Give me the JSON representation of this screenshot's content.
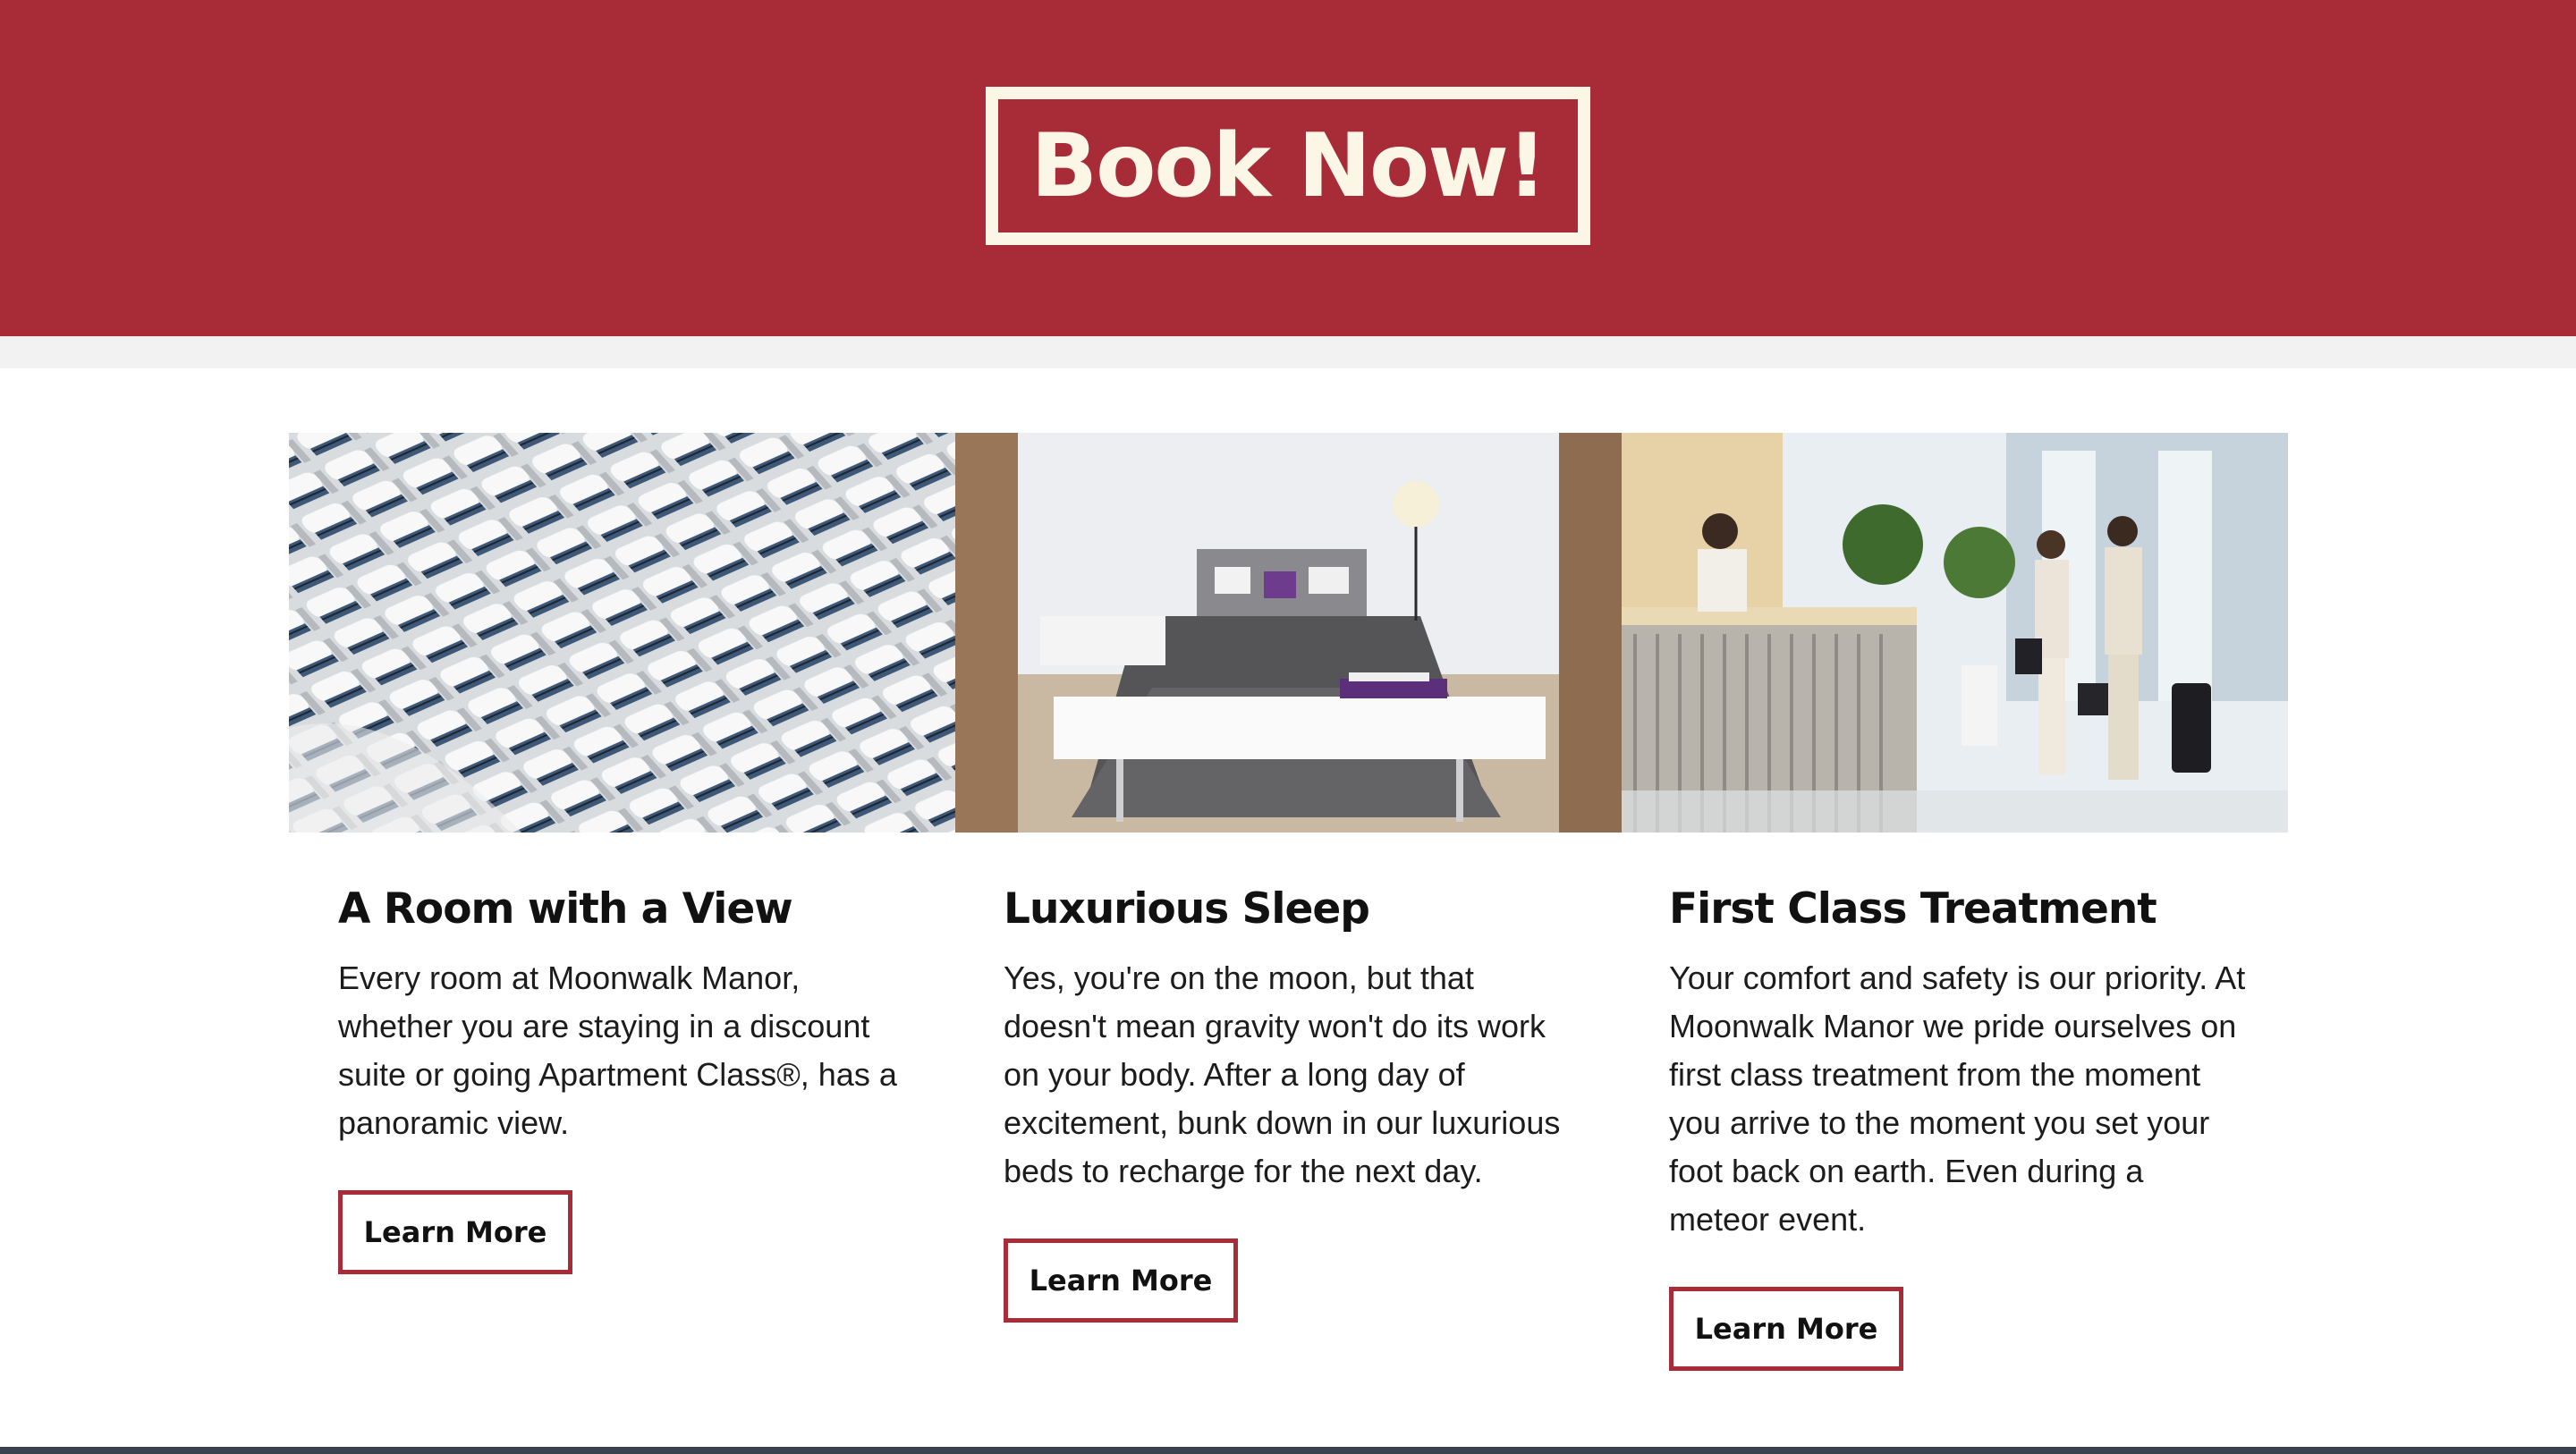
{
  "banner": {
    "book_label": "Book Now!"
  },
  "colors": {
    "accent": "#a72c38",
    "cream": "#fbf6e6",
    "band": "#f2f2f2"
  },
  "features": [
    {
      "image": "hotel-balconies-photo",
      "title": "A Room with a View",
      "text": "Every room at Moonwalk Manor, whether you are staying in a discount suite or going Apartment Class®, has a panoramic view.",
      "button_label": "Learn More"
    },
    {
      "image": "bedroom-photo",
      "title": "Luxurious Sleep",
      "text": "Yes, you're on the moon, but that doesn't mean gravity won't do its work on your body. After a long day of excitement, bunk down in our luxurious beds to recharge for the next day.",
      "button_label": "Learn More"
    },
    {
      "image": "hotel-lobby-photo",
      "title": "First Class Treatment",
      "text": "Your comfort and safety is our priority. At Moonwalk Manor we pride ourselves on first class treatment from the moment you arrive to the moment you set your foot back on earth. Even during a meteor event.",
      "button_label": "Learn More"
    }
  ]
}
